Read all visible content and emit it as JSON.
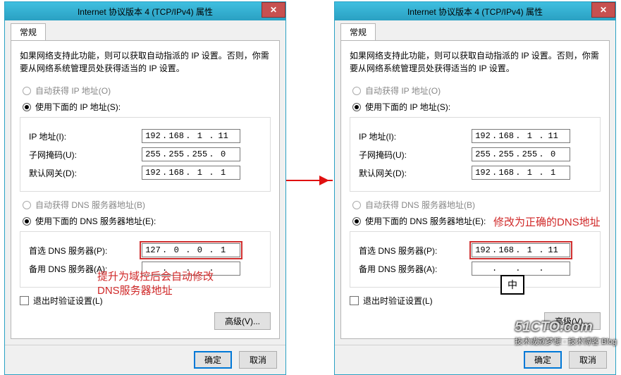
{
  "window_title": "Internet 协议版本 4 (TCP/IPv4) 属性",
  "tab": "常规",
  "description": "如果网络支持此功能，则可以获取自动指派的 IP 设置。否则，你需要从网络系统管理员处获得适当的 IP 设置。",
  "ip_section": {
    "auto_label": "自动获得 IP 地址(O)",
    "manual_label": "使用下面的 IP 地址(S):",
    "rows": {
      "ip": {
        "label": "IP 地址(I):",
        "a": "192",
        "b": "168",
        "c": "1",
        "d": "11"
      },
      "mask": {
        "label": "子网掩码(U):",
        "a": "255",
        "b": "255",
        "c": "255",
        "d": "0"
      },
      "gateway": {
        "label": "默认网关(D):",
        "a": "192",
        "b": "168",
        "c": "1",
        "d": "1"
      }
    }
  },
  "dns_section": {
    "auto_label": "自动获得 DNS 服务器地址(B)",
    "manual_label": "使用下面的 DNS 服务器地址(E):",
    "rows": {
      "pref": {
        "label": "首选 DNS 服务器(P):"
      },
      "alt": {
        "label": "备用 DNS 服务器(A):"
      }
    }
  },
  "left_dns": {
    "pref": {
      "a": "127",
      "b": "0",
      "c": "0",
      "d": "1"
    },
    "alt": {
      "a": "",
      "b": "",
      "c": "",
      "d": ""
    }
  },
  "right_dns": {
    "pref": {
      "a": "192",
      "b": "168",
      "c": "1",
      "d": "11"
    },
    "alt": {
      "a": "",
      "b": "",
      "c": "",
      "d": ""
    }
  },
  "validate_label": "退出时验证设置(L)",
  "advanced_btn": "高级(V)...",
  "ok_btn": "确定",
  "cancel_btn": "取消",
  "annotation_left": "提升为域控后会自动修改\nDNS服务器地址",
  "annotation_right": "修改为正确的DNS地址",
  "ime_char": "中",
  "watermark": {
    "main": "51CTO.com",
    "sub": "技术成就梦想 · 技术博客 Blog"
  }
}
